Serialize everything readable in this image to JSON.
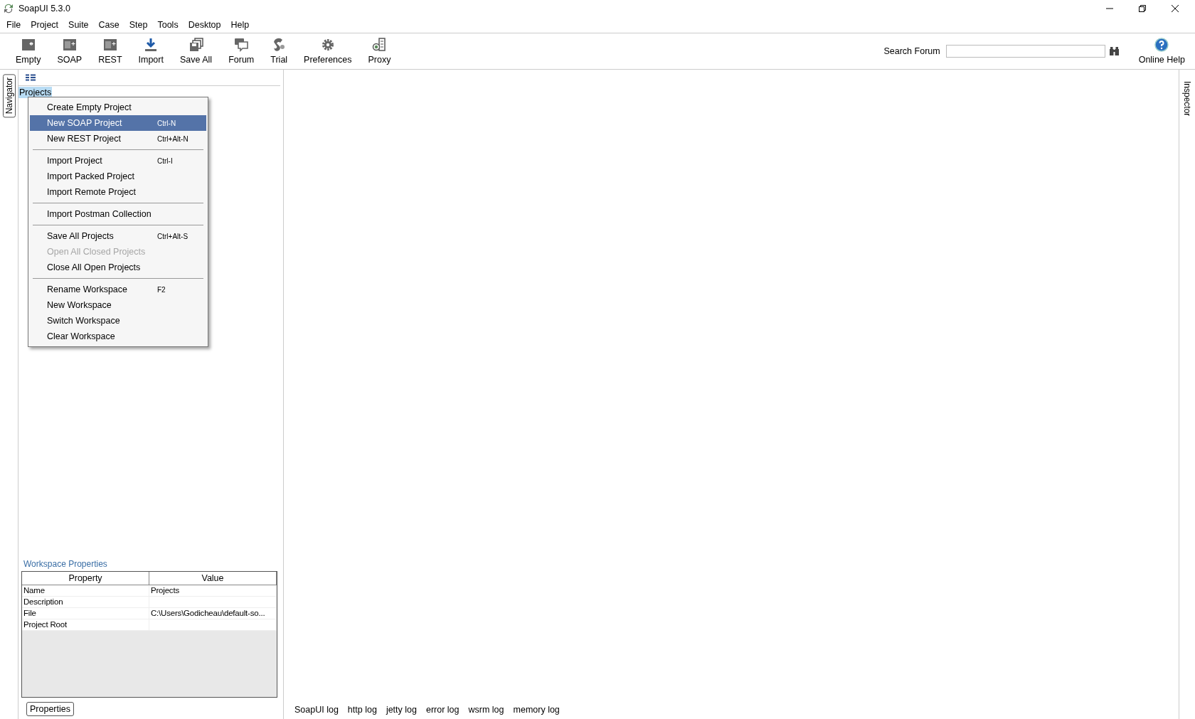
{
  "window": {
    "title": "SoapUI 5.3.0"
  },
  "menu_bar": [
    "File",
    "Project",
    "Suite",
    "Case",
    "Step",
    "Tools",
    "Desktop",
    "Help"
  ],
  "toolbar": [
    {
      "kind": "empty",
      "label": "Empty"
    },
    {
      "kind": "soap",
      "label": "SOAP"
    },
    {
      "kind": "rest",
      "label": "REST"
    },
    {
      "kind": "import",
      "label": "Import"
    },
    {
      "kind": "save-all",
      "label": "Save All"
    },
    {
      "kind": "forum",
      "label": "Forum"
    },
    {
      "kind": "trial",
      "label": "Trial"
    },
    {
      "kind": "preferences",
      "label": "Preferences"
    },
    {
      "kind": "proxy",
      "label": "Proxy"
    }
  ],
  "search": {
    "label": "Search Forum"
  },
  "online_help": {
    "label": "Online Help"
  },
  "side_tabs": {
    "left": "Navigator",
    "right": "Inspector"
  },
  "navigator": {
    "root": {
      "label": "Projects",
      "selected": true
    }
  },
  "context_menu": [
    [
      {
        "label": "Create Empty Project",
        "selected": false,
        "disabled": false
      },
      {
        "label": "New SOAP Project",
        "shortcut": "Ctrl-N",
        "selected": true,
        "disabled": false
      },
      {
        "label": "New REST Project",
        "shortcut": "Ctrl+Alt-N",
        "selected": false,
        "disabled": false
      }
    ],
    [
      {
        "label": "Import Project",
        "shortcut": "Ctrl-I",
        "selected": false,
        "disabled": false
      },
      {
        "label": "Import Packed Project",
        "selected": false,
        "disabled": false
      },
      {
        "label": "Import Remote Project",
        "selected": false,
        "disabled": false
      }
    ],
    [
      {
        "label": "Import Postman Collection",
        "selected": false,
        "disabled": false
      }
    ],
    [
      {
        "label": "Save All Projects",
        "shortcut": "Ctrl+Alt-S",
        "selected": false,
        "disabled": false
      },
      {
        "label": "Open All Closed Projects",
        "selected": false,
        "disabled": true
      },
      {
        "label": "Close All Open Projects",
        "selected": false,
        "disabled": false
      }
    ],
    [
      {
        "label": "Rename Workspace",
        "shortcut": "F2",
        "selected": false,
        "disabled": false
      },
      {
        "label": "New Workspace",
        "selected": false,
        "disabled": false
      },
      {
        "label": "Switch Workspace",
        "selected": false,
        "disabled": false
      },
      {
        "label": "Clear Workspace",
        "selected": false,
        "disabled": false
      }
    ]
  ],
  "workspace_properties": {
    "title": "Workspace Properties",
    "columns": [
      "Property",
      "Value"
    ],
    "rows": [
      {
        "property": "Name",
        "value": "Projects"
      },
      {
        "property": "Description"
      },
      {
        "property": "File",
        "value": "C:\\Users\\Godicheau\\default-so..."
      },
      {
        "property": "Project Root"
      }
    ],
    "button": "Properties"
  },
  "log_tabs": [
    "SoapUI log",
    "http log",
    "jetty log",
    "error log",
    "wsrm log",
    "memory log"
  ]
}
